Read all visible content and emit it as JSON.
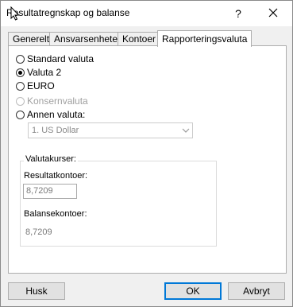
{
  "window": {
    "title": "Resultatregnskap og balanse",
    "help": "?"
  },
  "tabs": [
    "Generelt",
    "Ansvarsenheter",
    "Kontoer",
    "Rapporteringsvaluta"
  ],
  "radios": [
    {
      "label": "Standard valuta",
      "checked": false,
      "disabled": false
    },
    {
      "label": "Valuta 2",
      "checked": true,
      "disabled": false
    },
    {
      "label": "EURO",
      "checked": false,
      "disabled": false
    },
    {
      "label": "Konsernvaluta",
      "checked": false,
      "disabled": true
    },
    {
      "label": "Annen valuta:",
      "checked": false,
      "disabled": false
    }
  ],
  "other_currency": {
    "selected": "1. US Dollar"
  },
  "rates": {
    "legend": "Valutakurser:",
    "result_label": "Resultatkontoer:",
    "result_value": "8,7209",
    "balance_label": "Balansekontoer:",
    "balance_value": "8,7209"
  },
  "buttons": {
    "remember": "Husk",
    "ok": "OK",
    "cancel": "Avbryt"
  }
}
